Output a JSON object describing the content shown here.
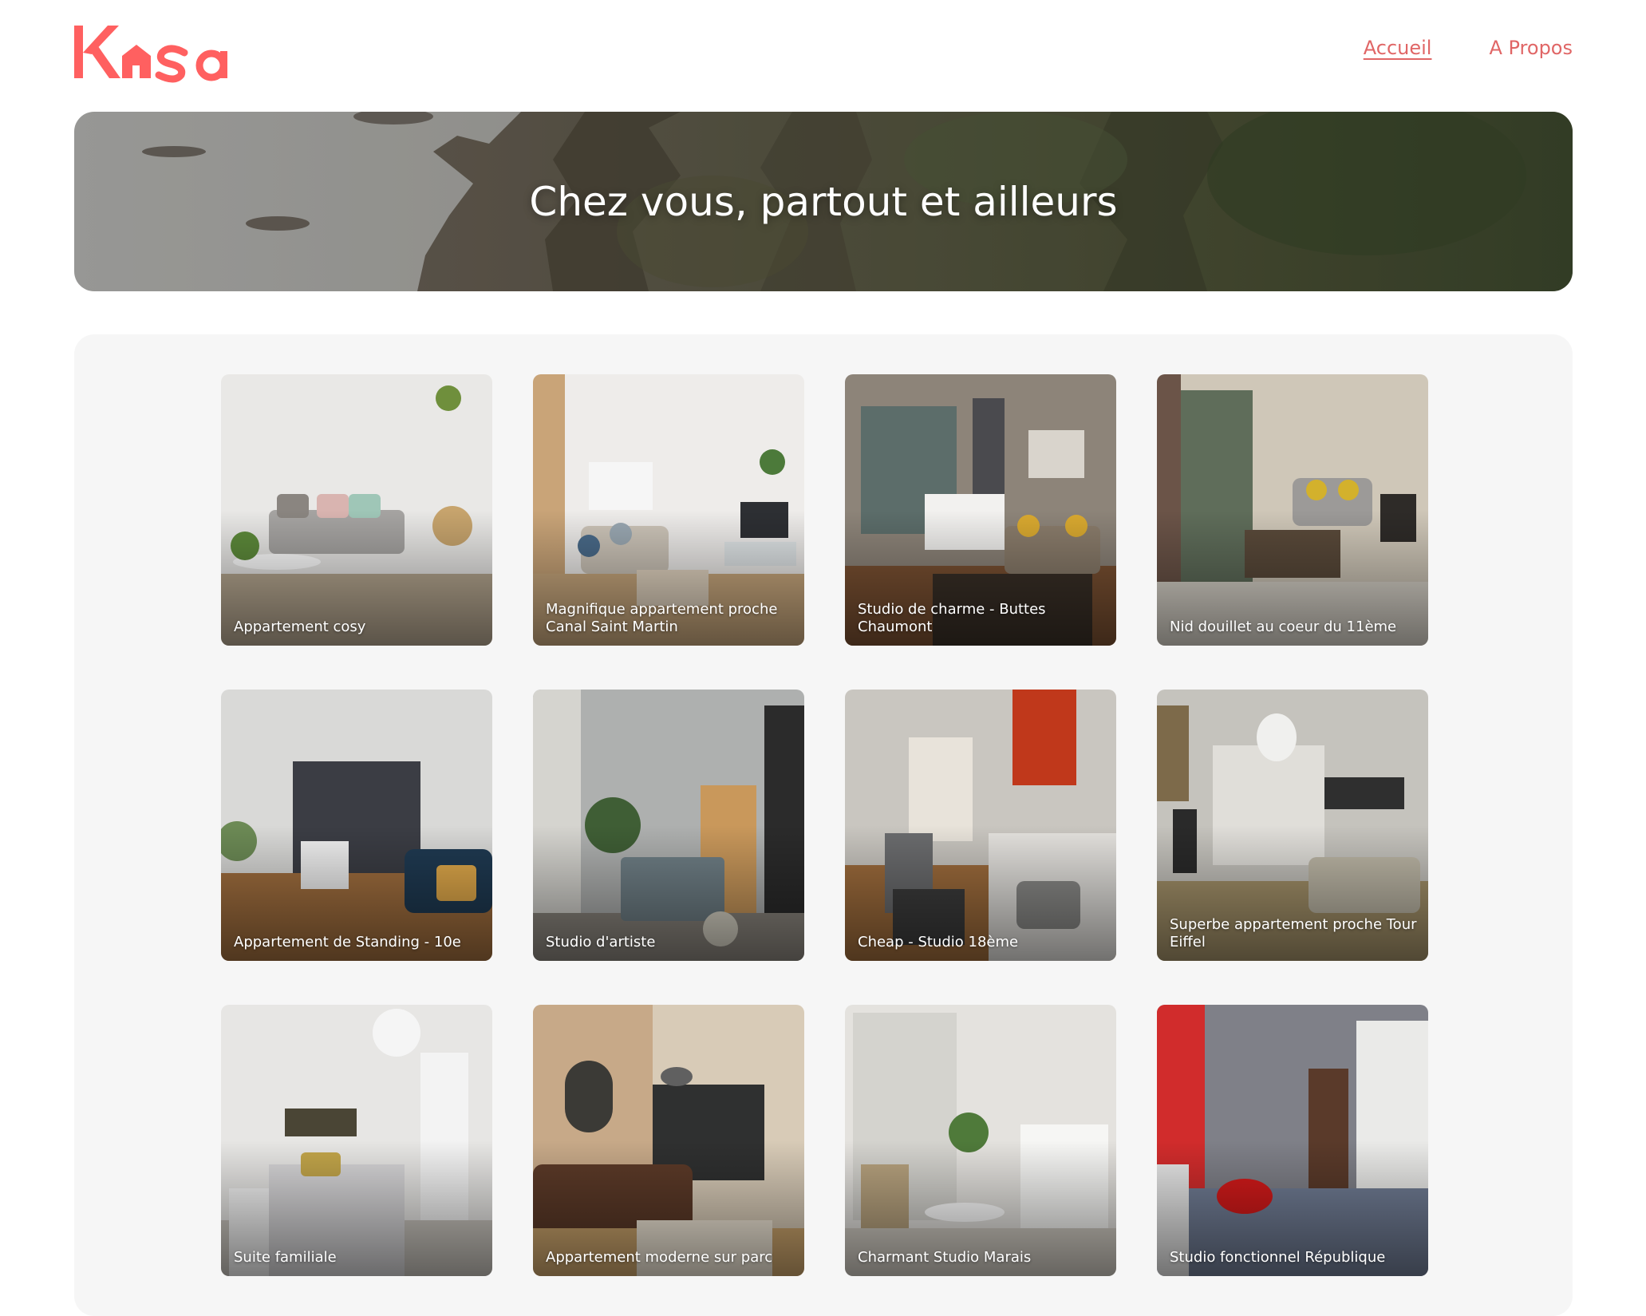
{
  "brand": {
    "logo_text": "Kasa",
    "accent_color": "#ff6060"
  },
  "nav": {
    "items": [
      {
        "label": "Accueil",
        "active": true
      },
      {
        "label": "A Propos",
        "active": false
      }
    ]
  },
  "banner": {
    "title": "Chez vous, partout et ailleurs"
  },
  "listings": [
    {
      "title": "Appartement cosy"
    },
    {
      "title": "Magnifique appartement proche Canal Saint Martin"
    },
    {
      "title": "Studio de charme - Buttes Chaumont"
    },
    {
      "title": "Nid douillet au coeur du 11ème"
    },
    {
      "title": "Appartement de Standing - 10e"
    },
    {
      "title": "Studio d'artiste"
    },
    {
      "title": "Cheap - Studio 18ème"
    },
    {
      "title": "Superbe appartement proche Tour Eiffel"
    },
    {
      "title": "Suite familiale"
    },
    {
      "title": "Appartement moderne sur parc"
    },
    {
      "title": "Charmant Studio Marais"
    },
    {
      "title": "Studio fonctionnel République"
    }
  ]
}
